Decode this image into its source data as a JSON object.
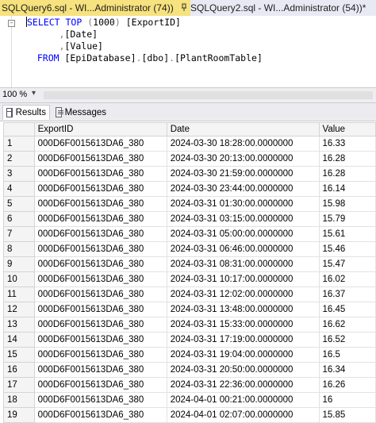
{
  "tabs": [
    {
      "label": "SQLQuery6.sql - WI...Administrator (74))",
      "active": true,
      "icon": "pin-icon"
    },
    {
      "label": "SQLQuery2.sql - WI...Administrator (54))*",
      "active": false,
      "icon": "close-icon"
    }
  ],
  "tab_close_glyph": "×",
  "editor": {
    "line1": {
      "kw1": "SELECT",
      "kw2": "TOP",
      "paren_open": "(",
      "num": "1000",
      "paren_close": ")",
      "bracket_open": "[",
      "col": "ExportID",
      "bracket_close": "]"
    },
    "line2": {
      "comma": ",",
      "col": "Date"
    },
    "line3": {
      "comma": ",",
      "col": "Value"
    },
    "line4": {
      "kw": "FROM",
      "db": "EpiDatabase",
      "schema": "dbo",
      "table": "PlantRoomTable"
    }
  },
  "zoom": "100 %",
  "result_tabs": {
    "results": "Results",
    "messages": "Messages"
  },
  "grid": {
    "columns": [
      "ExportID",
      "Date",
      "Value"
    ],
    "rows": [
      [
        "1",
        "000D6F0015613DA6_380",
        "2024-03-30 18:28:00.0000000",
        "16.33"
      ],
      [
        "2",
        "000D6F0015613DA6_380",
        "2024-03-30 20:13:00.0000000",
        "16.28"
      ],
      [
        "3",
        "000D6F0015613DA6_380",
        "2024-03-30 21:59:00.0000000",
        "16.28"
      ],
      [
        "4",
        "000D6F0015613DA6_380",
        "2024-03-30 23:44:00.0000000",
        "16.14"
      ],
      [
        "5",
        "000D6F0015613DA6_380",
        "2024-03-31 01:30:00.0000000",
        "15.98"
      ],
      [
        "6",
        "000D6F0015613DA6_380",
        "2024-03-31 03:15:00.0000000",
        "15.79"
      ],
      [
        "7",
        "000D6F0015613DA6_380",
        "2024-03-31 05:00:00.0000000",
        "15.61"
      ],
      [
        "8",
        "000D6F0015613DA6_380",
        "2024-03-31 06:46:00.0000000",
        "15.46"
      ],
      [
        "9",
        "000D6F0015613DA6_380",
        "2024-03-31 08:31:00.0000000",
        "15.47"
      ],
      [
        "10",
        "000D6F0015613DA6_380",
        "2024-03-31 10:17:00.0000000",
        "16.02"
      ],
      [
        "11",
        "000D6F0015613DA6_380",
        "2024-03-31 12:02:00.0000000",
        "16.37"
      ],
      [
        "12",
        "000D6F0015613DA6_380",
        "2024-03-31 13:48:00.0000000",
        "16.45"
      ],
      [
        "13",
        "000D6F0015613DA6_380",
        "2024-03-31 15:33:00.0000000",
        "16.62"
      ],
      [
        "14",
        "000D6F0015613DA6_380",
        "2024-03-31 17:19:00.0000000",
        "16.52"
      ],
      [
        "15",
        "000D6F0015613DA6_380",
        "2024-03-31 19:04:00.0000000",
        "16.5"
      ],
      [
        "16",
        "000D6F0015613DA6_380",
        "2024-03-31 20:50:00.0000000",
        "16.34"
      ],
      [
        "17",
        "000D6F0015613DA6_380",
        "2024-03-31 22:36:00.0000000",
        "16.26"
      ],
      [
        "18",
        "000D6F0015613DA6_380",
        "2024-04-01 00:21:00.0000000",
        "16"
      ],
      [
        "19",
        "000D6F0015613DA6_380",
        "2024-04-01 02:07:00.0000000",
        "15.85"
      ]
    ]
  },
  "colors": {
    "active_tab": "#f6e27e",
    "keyword": "#0000ff",
    "punct": "#808080",
    "function": "#ff00ff"
  }
}
